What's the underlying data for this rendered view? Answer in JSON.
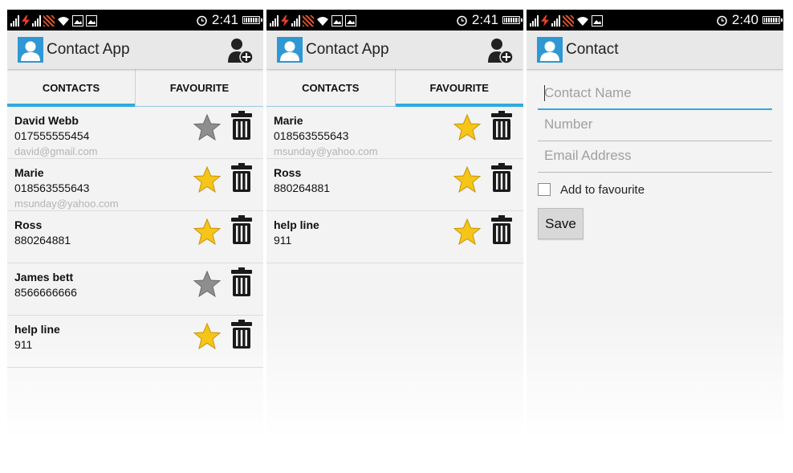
{
  "status_bar_1": {
    "time": "2:41"
  },
  "status_bar_2": {
    "time": "2:41"
  },
  "status_bar_3": {
    "time": "2:40"
  },
  "screen1": {
    "app_title": "Contact App",
    "tabs": [
      {
        "label": "CONTACTS",
        "active": true
      },
      {
        "label": "FAVOURITE",
        "active": false
      }
    ],
    "contacts": [
      {
        "name": "David Webb",
        "number": "017555555454",
        "email": "david@gmail.com",
        "favourite": false
      },
      {
        "name": "Marie",
        "number": "018563555643",
        "email": "msunday@yahoo.com",
        "favourite": true
      },
      {
        "name": "Ross",
        "number": "880264881",
        "email": "",
        "favourite": true
      },
      {
        "name": "James bett",
        "number": "8566666666",
        "email": "",
        "favourite": false
      },
      {
        "name": "help line",
        "number": "911",
        "email": "",
        "favourite": true
      }
    ]
  },
  "screen2": {
    "app_title": "Contact App",
    "tabs": [
      {
        "label": "CONTACTS",
        "active": false
      },
      {
        "label": "FAVOURITE",
        "active": true
      }
    ],
    "contacts": [
      {
        "name": "Marie",
        "number": "018563555643",
        "email": "msunday@yahoo.com",
        "favourite": true
      },
      {
        "name": "Ross",
        "number": "880264881",
        "email": "",
        "favourite": true
      },
      {
        "name": "help line",
        "number": "911",
        "email": "",
        "favourite": true
      }
    ]
  },
  "screen3": {
    "app_title": "Contact",
    "form": {
      "name_placeholder": "Contact Name",
      "number_placeholder": "Number",
      "email_placeholder": "Email Address",
      "favourite_label": "Add to favourite",
      "favourite_checked": false,
      "save_label": "Save"
    }
  },
  "colors": {
    "accent": "#2eaadf",
    "star_on": "#f5c518",
    "star_off": "#8e8e8e",
    "appbar": "#e8e8e8"
  },
  "icons": {
    "logo": "person-avatar-icon",
    "add": "add-contact-icon",
    "favourite": "star-icon",
    "delete": "trash-icon"
  }
}
